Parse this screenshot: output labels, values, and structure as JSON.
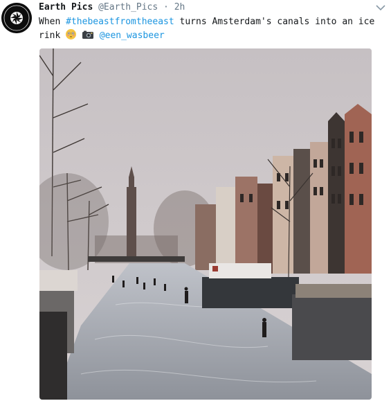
{
  "tweet": {
    "author_name": "Earth Pics",
    "author_handle": "@Earth_Pics",
    "separator": "·",
    "time": "2h",
    "text_before": "When ",
    "hashtag": "#thebeastfromtheeast",
    "text_middle": " turns Amsterdam's canals into an ice rink ",
    "mention": "@een_wasbeer"
  },
  "icons": {
    "avatar": "earth-pics-logo",
    "emoji_1": "flushed-face-icon",
    "emoji_2": "camera-flash-icon",
    "menu": "chevron-down-icon"
  },
  "colors": {
    "link": "#1b95e0",
    "secondary": "#657786"
  }
}
